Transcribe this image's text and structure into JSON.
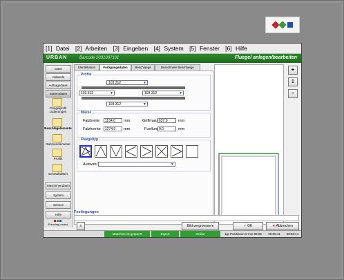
{
  "brand_logo_colors": [
    "#c8202a",
    "#3a9a3a",
    "#1f4fb0"
  ],
  "menu": [
    {
      "key": "[1]",
      "label": "Datei"
    },
    {
      "key": "[2]",
      "label": "Arbeiten"
    },
    {
      "key": "[3]",
      "label": "Eingeben"
    },
    {
      "key": "[4]",
      "label": "System"
    },
    {
      "key": "[5]",
      "label": "Fenster"
    },
    {
      "key": "[6]",
      "label": "Hilfe"
    }
  ],
  "titlebar": {
    "brand": "URBAN",
    "subtitle": "Barcode 2031007101",
    "title": "Fluegel anlegen/bearbeiten",
    "accent": "#2b8a2b"
  },
  "sidebar": {
    "top_buttons": [
      "Datei",
      "Ablaeufe",
      "Auftragsdaten",
      "Stammdaten"
    ],
    "icons": [
      {
        "icon": "folder-icon",
        "label": "Fluegelprofil\ncodierungen"
      },
      {
        "icon": "folder-icon",
        "label": "Beschlagelemente",
        "bold": true
      },
      {
        "icon": "folder-icon",
        "label": "Rahmenelemente"
      },
      {
        "icon": "folder-icon",
        "label": "Profile"
      },
      {
        "icon": "folder-icon",
        "label": "Schraubdaten"
      }
    ],
    "bottom_buttons": [
      "Maschinendaten",
      "System",
      "Service",
      "Hilfe"
    ],
    "footer": "Planning control"
  },
  "tabs": [
    {
      "label": "Identifikation",
      "active": false
    },
    {
      "label": "Fertigungsdaten",
      "active": true
    },
    {
      "label": "Beschlaege",
      "active": false
    },
    {
      "label": "Berechnete Beschlaege",
      "active": false
    }
  ],
  "profile": {
    "label": "Profile",
    "top": "103.312",
    "left": "103.312",
    "right": "103.312",
    "bottom": "103.312"
  },
  "masse": {
    "label": "Masse",
    "falzbreite_label": "Falzbreite",
    "falzbreite": "1134.0",
    "falzhoehe_label": "Falzhoehe",
    "falzhoehe": "1274.0",
    "griffmass_label": "Griffmass",
    "griffmass": "637.0",
    "fuellung_label": "Fuellung",
    "fuellung": "0.0",
    "unit": "mm"
  },
  "fluegeltyp": {
    "label": "Fluegeltyp",
    "shapes": [
      "tilt-turn-left-icon",
      "tilt-icon",
      "turn-left-icon",
      "turn-left-alt-icon",
      "turn-right-icon",
      "double-turn-icon",
      "turn-right-alt-icon",
      "fixed-icon"
    ],
    "auswahl_label": "Auswahl",
    "auswahl_value": ""
  },
  "preview_tools": [
    "plus-icon",
    "page-icon",
    "minus-icon"
  ],
  "festlegungen_label": "Festlegungen",
  "buttons": {
    "small": "≡",
    "bild": "Bild vergroessern",
    "ok": "OK",
    "abbrechen": "Abbrechen"
  },
  "status": {
    "state1": "Maschine ist gesperrt",
    "state2": "Export",
    "state3": "Online",
    "pos": "1gr Positionen 8 mm 06:06",
    "date": "05.05.11",
    "time": "09:53:14",
    "green": "#2fa02f"
  }
}
